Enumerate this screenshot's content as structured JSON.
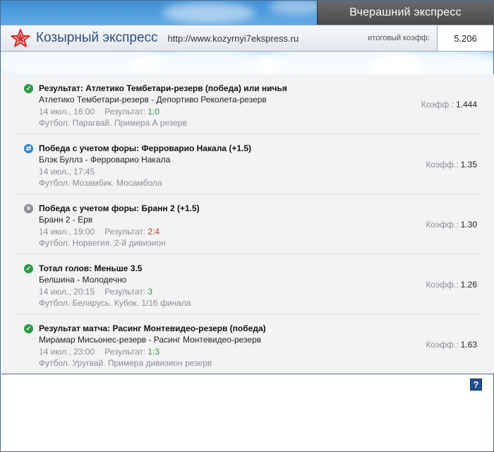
{
  "header": {
    "badge": "Вчерашний экспресс",
    "brand": "Козырный экспресс",
    "url": "http://www.kozyrnyi7ekspress.ru",
    "total_label": "итоговый коэфф:",
    "total_value": "5.206"
  },
  "bets": [
    {
      "status": "win",
      "title": "Результат: Атлетико Тембетари-резерв (победа) или ничья",
      "teams": "Атлетико Тембетари-резерв - Депортиво Реколета-резерв",
      "datetime": "14 июл., 16:00",
      "result_label": "Результат:",
      "result": "1:0",
      "league": "Футбол. Парагвай. Примера А резерв",
      "coef_label": "Коэфф.:",
      "coef": "1.444"
    },
    {
      "status": "return",
      "title": "Победа с учетом форы: Ферроварио Накала (+1.5)",
      "teams": "Блэк Буллз - Ферроварио Накала",
      "datetime": "14 июл., 17:45",
      "result_label": "",
      "result": "",
      "league": "Футбол. Мозамбик. Мосамбола",
      "coef_label": "Коэфф.:",
      "coef": "1.35"
    },
    {
      "status": "lose",
      "title": "Победа с учетом форы: Бранн 2 (+1.5)",
      "teams": "Бранн 2 - Ерв",
      "datetime": "14 июл., 19:00",
      "result_label": "Результат:",
      "result": "2:4",
      "league": "Футбол. Норвегия. 2-й дивизион",
      "coef_label": "Коэфф.:",
      "coef": "1.30"
    },
    {
      "status": "win",
      "title": "Тотал голов: Меньше 3.5",
      "teams": "Белшина - Молодечно",
      "datetime": "14 июл., 20:15",
      "result_label": "Результат:",
      "result": "3",
      "league": "Футбол. Беларусь. Кубок. 1/16 финала",
      "coef_label": "Коэфф.:",
      "coef": "1.26"
    },
    {
      "status": "win",
      "title": "Результат матча: Расинг Монтевидео-резерв (победа)",
      "teams": "Мирамар Мисьонес-резерв - Расинг Монтевидео-резерв",
      "datetime": "14 июл., 23:00",
      "result_label": "Результат:",
      "result": "1:3",
      "league": "Футбол. Уругвай. Примера дивизион резерв",
      "coef_label": "Коэфф.:",
      "coef": "1.63"
    }
  ],
  "help_glyph": "?",
  "icons": {
    "logo": "red-star-icon",
    "win": "check-circle-icon",
    "return": "refresh-circle-icon",
    "lose": "x-circle-icon",
    "help": "help-icon"
  },
  "colors": {
    "accent": "#2c4f7c",
    "win": "#2e9a46",
    "lose": "#c0392b",
    "return": "#2f86c8",
    "logo": "#d6302a"
  }
}
